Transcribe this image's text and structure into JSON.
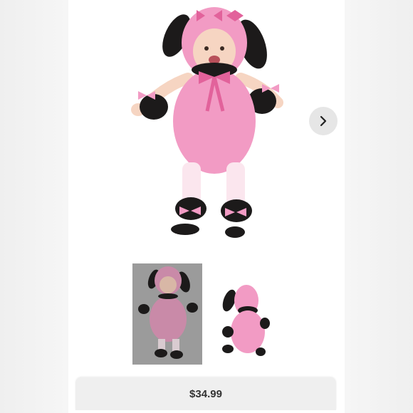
{
  "listing": {
    "price": "$34.99"
  },
  "carousel": {
    "next_icon": "chevron-right-icon"
  },
  "thumbnails": [
    {
      "selected": true
    },
    {
      "selected": false
    }
  ],
  "colors": {
    "costume_pink": "#f29bc4",
    "accent_black": "#1c1a1a",
    "thumb_selected_bg": "#9b9b9b"
  }
}
